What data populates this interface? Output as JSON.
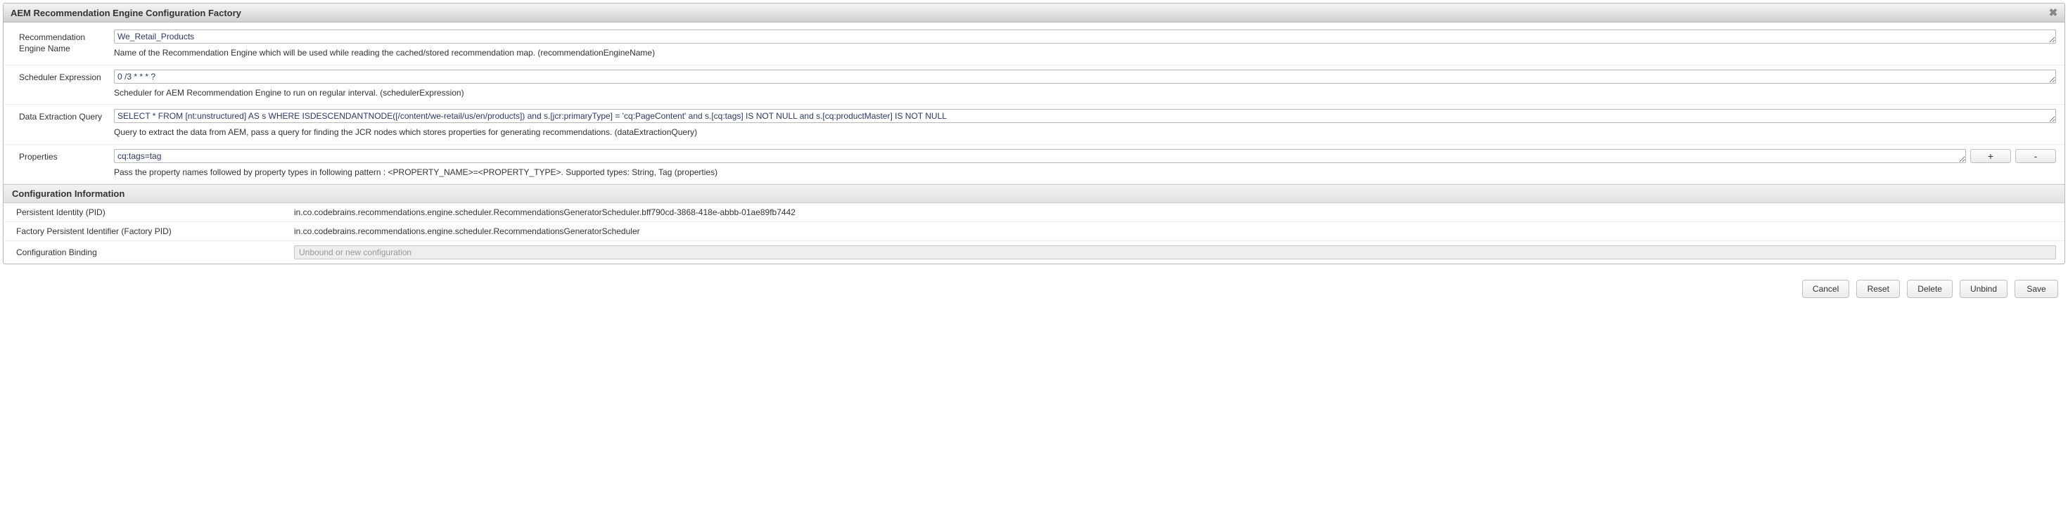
{
  "dialog": {
    "title": "AEM Recommendation Engine Configuration Factory",
    "close_label": "✖"
  },
  "fields": {
    "engineName": {
      "label": "Recommendation Engine Name",
      "value": "We_Retail_Products",
      "help": "Name of the Recommendation Engine which will be used while reading the cached/stored recommendation map. (recommendationEngineName)"
    },
    "scheduler": {
      "label": "Scheduler Expression",
      "value": "0 /3 * * * ?",
      "help": "Scheduler for AEM Recommendation Engine to run on regular interval. (schedulerExpression)"
    },
    "query": {
      "label": "Data Extraction Query",
      "value": "SELECT * FROM [nt:unstructured] AS s WHERE ISDESCENDANTNODE([/content/we-retail/us/en/products]) and s.[jcr:primaryType] = 'cq:PageContent' and s.[cq:tags] IS NOT NULL and s.[cq:productMaster] IS NOT NULL",
      "help": "Query to extract the data from AEM, pass a query for finding the JCR nodes which stores properties for generating recommendations. (dataExtractionQuery)"
    },
    "properties": {
      "label": "Properties",
      "value": "cq:tags=tag",
      "help": "Pass the property names followed by property types in following pattern : <PROPERTY_NAME>=<PROPERTY_TYPE>. Supported types: String, Tag (properties)",
      "plus": "+",
      "minus": "-"
    }
  },
  "configInfo": {
    "header": "Configuration Information",
    "pid": {
      "label": "Persistent Identity (PID)",
      "value": "in.co.codebrains.recommendations.engine.scheduler.RecommendationsGeneratorScheduler.bff790cd-3868-418e-abbb-01ae89fb7442"
    },
    "factoryPid": {
      "label": "Factory Persistent Identifier (Factory PID)",
      "value": "in.co.codebrains.recommendations.engine.scheduler.RecommendationsGeneratorScheduler"
    },
    "binding": {
      "label": "Configuration Binding",
      "value": "Unbound or new configuration"
    }
  },
  "buttons": {
    "cancel": "Cancel",
    "reset": "Reset",
    "delete": "Delete",
    "unbind": "Unbind",
    "save": "Save"
  }
}
